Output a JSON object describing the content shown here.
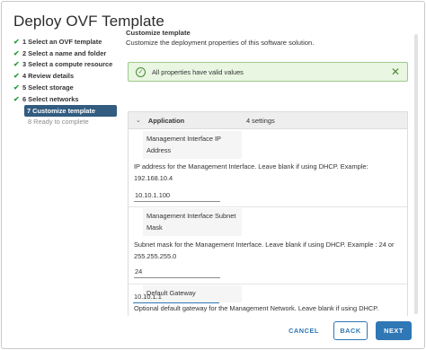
{
  "window": {
    "title": "Deploy OVF Template"
  },
  "steps": [
    {
      "label": "1 Select an OVF template",
      "state": "done"
    },
    {
      "label": "2 Select a name and folder",
      "state": "done"
    },
    {
      "label": "3 Select a compute resource",
      "state": "done"
    },
    {
      "label": "4 Review details",
      "state": "done"
    },
    {
      "label": "5 Select storage",
      "state": "done"
    },
    {
      "label": "6 Select networks",
      "state": "done"
    },
    {
      "label": "7 Customize template",
      "state": "active"
    },
    {
      "label": "8 Ready to complete",
      "state": "pending"
    }
  ],
  "section": {
    "title": "Customize template",
    "subtitle": "Customize the deployment properties of this software solution."
  },
  "alert": {
    "message": "All properties have valid values",
    "status_color": "#4a8b2e",
    "icon": "check-circle-icon"
  },
  "group": {
    "name": "Application",
    "count": "4 settings"
  },
  "properties": {
    "ip": {
      "label": "Management Interface IP Address",
      "description": "IP address for the Management Interface. Leave blank if using DHCP. Example: 192.168.10.4",
      "value": "10.10.1.100"
    },
    "mask": {
      "label": "Management Interface Subnet Mask",
      "description": "Subnet mask for the Management Interface. Leave blank if using DHCP. Example : 24 or 255.255.255.0",
      "value": "24"
    },
    "gateway": {
      "label": "Default Gateway",
      "description": "Optional default gateway for the Management Network. Leave blank if using DHCP.",
      "value": "10.10.1.1"
    }
  },
  "footer": {
    "cancel_label": "CANCEL",
    "back_label": "BACK",
    "next_label": "NEXT"
  },
  "colors": {
    "accent": "#2f77b5",
    "active_step": "#325c80",
    "check": "#2e9e3e"
  }
}
